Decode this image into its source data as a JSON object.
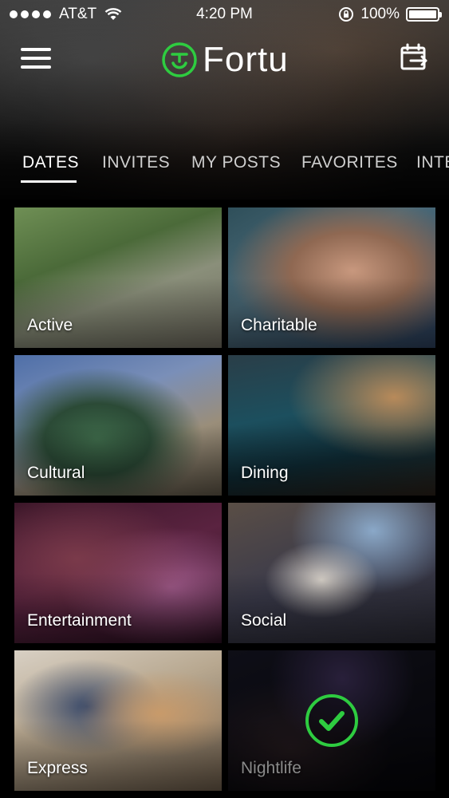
{
  "status_bar": {
    "carrier": "AT&T",
    "time": "4:20 PM",
    "battery": "100%",
    "battery_level": 1.0
  },
  "header": {
    "logo_text": "Fortu",
    "brand_color": "#2ecc40",
    "menu_icon": "hamburger-menu-icon",
    "calendar_icon": "calendar-export-icon"
  },
  "tabs": [
    {
      "label": "DATES",
      "active": true
    },
    {
      "label": "INVITES",
      "active": false
    },
    {
      "label": "MY POSTS",
      "active": false
    },
    {
      "label": "FAVORITES",
      "active": false
    },
    {
      "label": "INTE",
      "active": false
    }
  ],
  "categories": [
    {
      "label": "Active",
      "selected": false
    },
    {
      "label": "Charitable",
      "selected": false
    },
    {
      "label": "Cultural",
      "selected": false
    },
    {
      "label": "Dining",
      "selected": false
    },
    {
      "label": "Entertainment",
      "selected": false
    },
    {
      "label": "Social",
      "selected": false
    },
    {
      "label": "Express",
      "selected": false
    },
    {
      "label": "Nightlife",
      "selected": true
    }
  ],
  "selection": {
    "check_icon": "checkmark-circle-icon",
    "check_color": "#2ecc40"
  }
}
